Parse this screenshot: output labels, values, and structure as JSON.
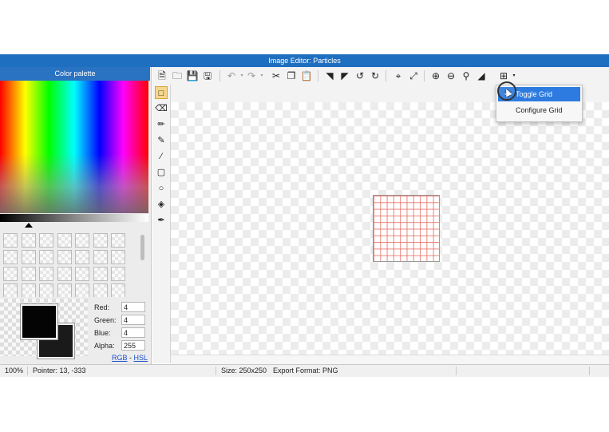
{
  "window": {
    "title": "Image Editor: Particles"
  },
  "palette": {
    "header": "Color palette",
    "fields": [
      {
        "label": "Red:",
        "value": "4"
      },
      {
        "label": "Green:",
        "value": "4"
      },
      {
        "label": "Blue:",
        "value": "4"
      },
      {
        "label": "Alpha:",
        "value": "255"
      }
    ],
    "mode_rgb": "RGB",
    "mode_sep": " - ",
    "mode_hsl": "HSL",
    "primary_color": "#040404",
    "secondary_color": "#1a1a1a"
  },
  "toolbar": {
    "icons": [
      "new-file-icon",
      "open-folder-icon",
      "save-icon",
      "save-as-icon",
      "undo-icon",
      "redo-icon",
      "cut-icon",
      "copy-icon",
      "paste-icon",
      "flip-horizontal-icon",
      "flip-vertical-icon",
      "rotate-left-icon",
      "rotate-right-icon",
      "crop-icon",
      "resize-icon",
      "zoom-in-icon",
      "zoom-out-icon",
      "zoom-fit-icon",
      "invert-icon",
      "grid-icon"
    ]
  },
  "tools": [
    "select-tool-icon",
    "eraser-icon",
    "pencil-icon",
    "brush-icon",
    "line-icon",
    "rectangle-icon",
    "ellipse-icon",
    "fill-bucket-icon",
    "eyedropper-icon"
  ],
  "grid_menu": {
    "toggle_label": "Toggle Grid",
    "toggle_checked": true,
    "configure_label": "Configure Grid"
  },
  "status": {
    "zoom": "100%",
    "pointer": "Pointer: 13, -333",
    "size": "Size: 250x250",
    "export_format": "Export Format: PNG"
  },
  "colors": {
    "titlebar": "#1f6fc0",
    "menu_highlight": "#2d7be0",
    "grid_line": "#e66e64"
  }
}
